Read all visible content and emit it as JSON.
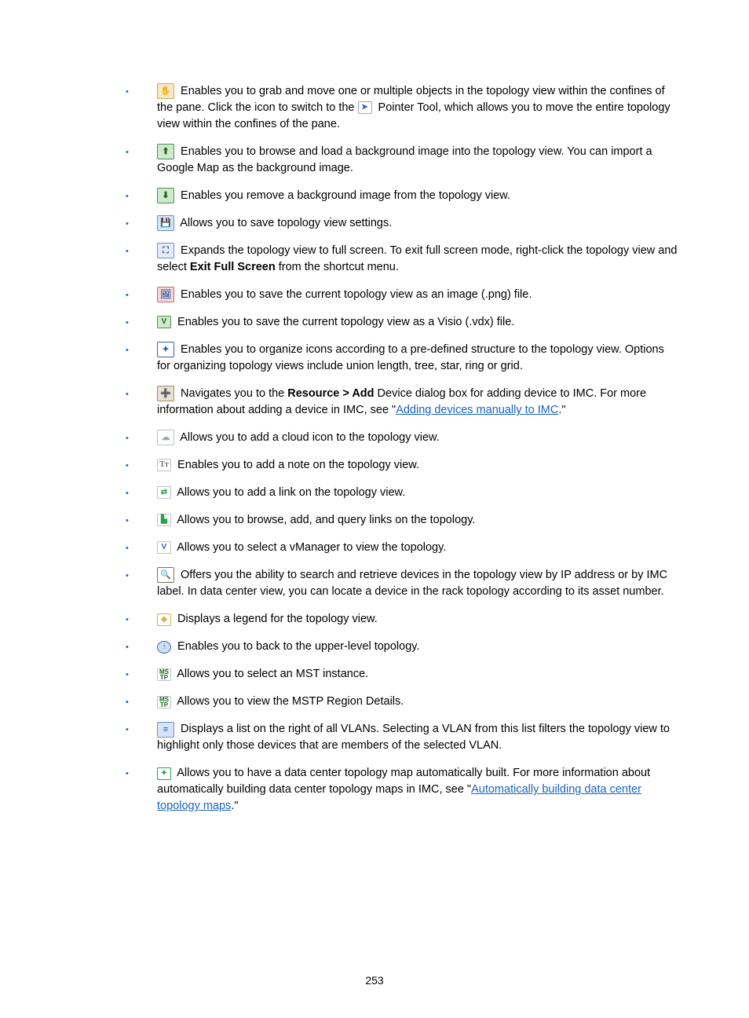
{
  "page_number": "253",
  "bold": {
    "exit_full_screen": "Exit Full Screen",
    "resource_add": "Resource > Add"
  },
  "links": {
    "adding_devices": "Adding devices manually to IMC",
    "auto_build": "Automatically building data center topology maps"
  },
  "items": {
    "i1a": "Enables you to grab and move one or multiple objects in the topology view within the confines of the pane. Click the icon to switch to the ",
    "i1b": " Pointer Tool, which allows you to move the entire topology view within the confines of the pane.",
    "i2": "Enables you to browse and load a background image into the topology view. You can import a Google Map as the background image.",
    "i3": "Enables you remove a background image from the topology view.",
    "i4": "Allows you to save topology view settings.",
    "i5a": "Expands the topology view to full screen. To exit full screen mode, right-click the topology view and select ",
    "i5b": " from the shortcut menu.",
    "i6": "Enables you to save the current topology view as an image (.png) file.",
    "i7": "Enables you to save the current topology view as a Visio (.vdx) file.",
    "i8": "Enables you to organize icons according to a pre-defined structure to the topology view. Options for organizing topology views include union length, tree, star, ring or grid.",
    "i9a": "Navigates you to the ",
    "i9b": " Device dialog box for adding device to IMC. For more information about adding a device in IMC, see \"",
    "i9c": ".\"",
    "i10": "Allows you to add a cloud icon to the topology view.",
    "i11": "Enables you to add a note on the topology view.",
    "i12": "Allows you to add a link on the topology view.",
    "i13": "Allows you to browse, add, and query links on the topology.",
    "i14": "Allows you to select a vManager to view the topology.",
    "i15": "Offers you the ability to search and retrieve devices in the topology view by IP address or by IMC label. In data center view, you can locate a device in the rack topology according to its asset number.",
    "i16": "Displays a legend for the topology view.",
    "i17": "Enables you to back to the upper-level topology.",
    "i18": "Allows you to select an MST instance.",
    "i19": "Allows you to view the MSTP Region Details.",
    "i20": "Displays a list on the right of all VLANs. Selecting a VLAN from this list filters the topology view to highlight only those devices that are members of the selected VLAN.",
    "i21a": "Allows you to have a data center topology map automatically built. For more information about automatically building data center topology maps in IMC, see \"",
    "i21b": ".\""
  }
}
